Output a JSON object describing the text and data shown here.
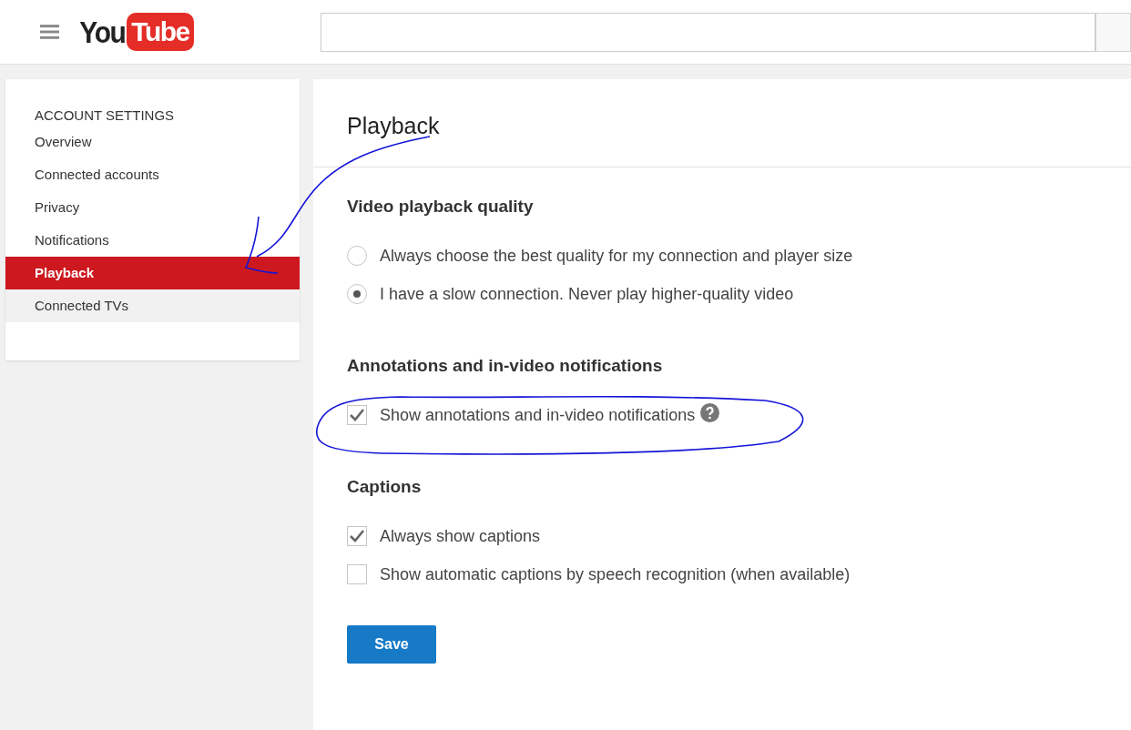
{
  "header": {
    "logo": {
      "part_1": "You",
      "part_2": "Tube"
    }
  },
  "sidebar": {
    "heading": "ACCOUNT SETTINGS",
    "items": [
      {
        "label": "Overview",
        "selected": false,
        "hovered": false
      },
      {
        "label": "Connected accounts",
        "selected": false,
        "hovered": false
      },
      {
        "label": "Privacy",
        "selected": false,
        "hovered": false
      },
      {
        "label": "Notifications",
        "selected": false,
        "hovered": false
      },
      {
        "label": "Playback",
        "selected": true,
        "hovered": false
      },
      {
        "label": "Connected TVs",
        "selected": false,
        "hovered": true
      }
    ]
  },
  "main": {
    "title": "Playback",
    "sections": [
      {
        "heading": "Video playback quality",
        "options": [
          {
            "kind": "radio",
            "label": "Always choose the best quality for my connection and player size",
            "checked": false,
            "help": false
          },
          {
            "kind": "radio",
            "label": "I have a slow connection. Never play higher-quality video",
            "checked": true,
            "help": false
          }
        ]
      },
      {
        "heading": "Annotations and in-video notifications",
        "options": [
          {
            "kind": "checkbox",
            "label": "Show annotations and in-video notifications",
            "checked": true,
            "help": true
          }
        ]
      },
      {
        "heading": "Captions",
        "options": [
          {
            "kind": "checkbox",
            "label": "Always show captions",
            "checked": true,
            "help": false
          },
          {
            "kind": "checkbox",
            "label": "Show automatic captions by speech recognition (when available)",
            "checked": false,
            "help": false
          }
        ]
      }
    ],
    "save_button": "Save"
  }
}
